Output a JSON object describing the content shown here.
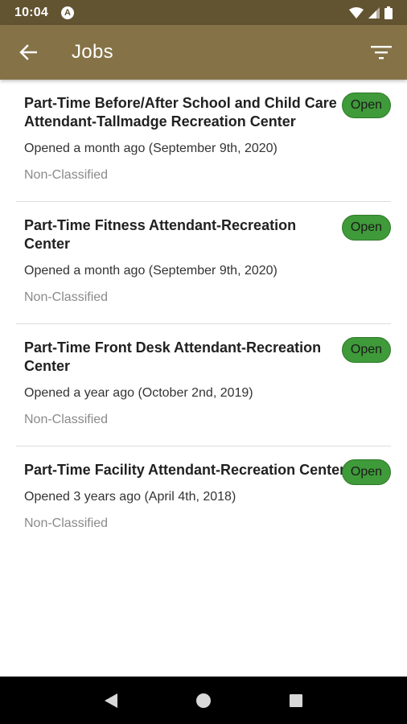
{
  "status_bar": {
    "time": "10:04",
    "app_badge": "A"
  },
  "app_bar": {
    "title": "Jobs",
    "back_icon": "arrow-left-icon",
    "filter_icon": "filter-icon",
    "background_color": "#857347"
  },
  "jobs": [
    {
      "title": "Part-Time Before/After School and Child Care Attendant-Tallmadge Recreation Center",
      "opened": "Opened a month ago (September 9th, 2020)",
      "classification": "Non-Classified",
      "status": "Open"
    },
    {
      "title": "Part-Time Fitness Attendant-Recreation Center",
      "opened": "Opened a month ago (September 9th, 2020)",
      "classification": "Non-Classified",
      "status": "Open"
    },
    {
      "title": "Part-Time Front Desk Attendant-Recreation Center",
      "opened": "Opened a year ago (October 2nd, 2019)",
      "classification": "Non-Classified",
      "status": "Open"
    },
    {
      "title": "Part-Time Facility Attendant-Recreation Center",
      "opened": "Opened 3 years ago (April 4th, 2018)",
      "classification": "Non-Classified",
      "status": "Open"
    }
  ],
  "colors": {
    "status_bar": "#625331",
    "open_badge": "#3f9a3a"
  },
  "nav_bar": {
    "back_icon": "nav-back-icon",
    "home_icon": "nav-home-icon",
    "recents_icon": "nav-recents-icon"
  }
}
